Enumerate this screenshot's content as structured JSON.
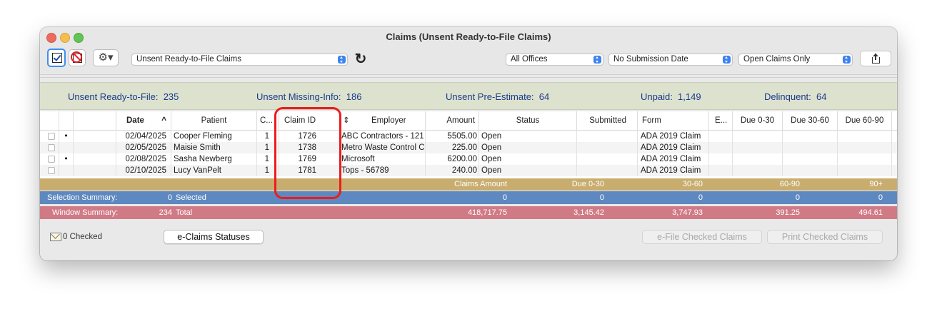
{
  "window": {
    "title": "Claims (Unsent Ready-to-File Claims)"
  },
  "toolbar": {
    "view_select": "Unsent Ready-to-File Claims",
    "offices_select": "All Offices",
    "submission_select": "No Submission Date",
    "claims_select": "Open Claims Only",
    "gear_glyph": "⚙▾",
    "refresh_glyph": "↻"
  },
  "summary": {
    "ready_label": "Unsent Ready-to-File:",
    "ready_value": "235",
    "missing_label": "Unsent Missing-Info:",
    "missing_value": "186",
    "pre_label": "Unsent Pre-Estimate:",
    "pre_value": "64",
    "unpaid_label": "Unpaid:",
    "unpaid_value": "1,149",
    "delinquent_label": "Delinquent:",
    "delinquent_value": "64"
  },
  "columns": {
    "date": "Date",
    "date_sort": "^",
    "patient": "Patient",
    "c": "C...",
    "claim_id": "Claim ID",
    "employer_sort": "⇕",
    "employer": "Employer",
    "amount": "Amount",
    "status": "Status",
    "submitted": "Submitted",
    "form": "Form",
    "e": "E...",
    "due_0_30": "Due 0-30",
    "due_30_60": "Due 30-60",
    "due_60_90": "Due 60-90"
  },
  "rows": [
    {
      "flag": "•",
      "date": "02/04/2025",
      "patient": "Cooper Fleming",
      "c": "1",
      "claim_id": "1726",
      "employer": "ABC Contractors - 121",
      "amount": "5505.00",
      "status": "Open",
      "form": "ADA 2019 Claim"
    },
    {
      "flag": "",
      "date": "02/05/2025",
      "patient": "Maisie Smith",
      "c": "1",
      "claim_id": "1738",
      "employer": "Metro Waste Control C",
      "amount": "225.00",
      "status": "Open",
      "form": "ADA 2019 Claim"
    },
    {
      "flag": "•",
      "date": "02/08/2025",
      "patient": "Sasha Newberg",
      "c": "1",
      "claim_id": "1769",
      "employer": "Microsoft",
      "amount": "6200.00",
      "status": "Open",
      "form": "ADA 2019 Claim"
    },
    {
      "flag": "",
      "date": "02/10/2025",
      "patient": "Lucy VanPelt",
      "c": "1",
      "claim_id": "1781",
      "employer": "Tops - 56789",
      "amount": "240.00",
      "status": "Open",
      "form": "ADA 2019 Claim"
    }
  ],
  "footer_header": {
    "claims_amount": "Claims Amount",
    "due_0_30": "Due 0-30",
    "b30_60": "30-60",
    "b60_90": "60-90",
    "b90": "90+"
  },
  "selection_summary": {
    "label": "Selection Summary:",
    "count": "0",
    "selected": "Selected",
    "amount": "0",
    "due_0_30": "0",
    "b30_60": "0",
    "b60_90": "0",
    "b90": "0"
  },
  "window_summary": {
    "label": "Window Summary:",
    "count": "234",
    "total": "Total",
    "amount": "418,717.75",
    "due_0_30": "3,145.42",
    "b30_60": "3,747.93",
    "b60_90": "391.25",
    "b90": "494.61"
  },
  "bottom": {
    "checked": "0 Checked",
    "eclaims_btn": "e-Claims Statuses",
    "efile_btn": "e-File Checked Claims",
    "print_btn": "Print Checked Claims"
  },
  "colors": {
    "highlight": "#ef1b1b",
    "summary_text": "#1b3a8c",
    "selection_bar": "#5e88c0",
    "window_bar": "#d07a86",
    "footer_header": "#c8ad6e"
  }
}
